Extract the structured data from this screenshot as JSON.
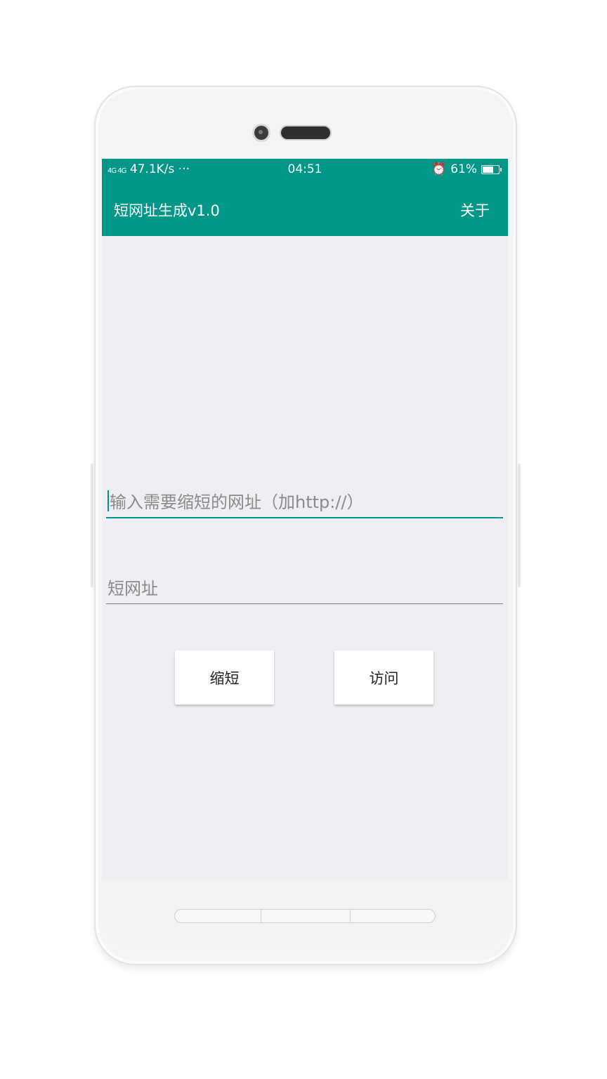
{
  "status_bar": {
    "signal": "4G 4G",
    "network_speed": "47.1K/s ···",
    "time": "04:51",
    "battery_percent": "61%",
    "battery_level": 0.61
  },
  "toolbar": {
    "title": "短网址生成v1.0",
    "menu_label": "关于"
  },
  "form": {
    "url_input_placeholder": "输入需要缩短的网址（加http://）",
    "short_url_placeholder": "短网址"
  },
  "buttons": {
    "shorten_label": "缩短",
    "visit_label": "访问"
  },
  "colors": {
    "primary": "#009688",
    "background": "#efeff3"
  },
  "icons": [
    "alarm-icon",
    "battery-icon",
    "signal-icon"
  ]
}
